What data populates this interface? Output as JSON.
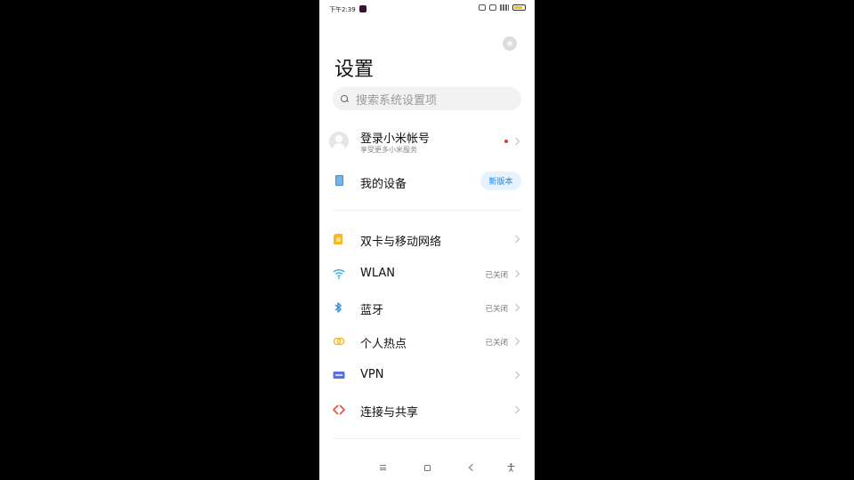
{
  "status_bar": {
    "time": "下午2:39"
  },
  "page": {
    "title": "设置"
  },
  "search": {
    "placeholder": "搜索系统设置项"
  },
  "account": {
    "title": "登录小米帐号",
    "subtitle": "享受更多小米服务"
  },
  "device": {
    "label": "我的设备",
    "badge": "新版本"
  },
  "items": [
    {
      "label": "双卡与移动网络",
      "status": "",
      "icon": "sim-card-icon",
      "color": "#f5b921"
    },
    {
      "label": "WLAN",
      "status": "已关闭",
      "icon": "wifi-icon",
      "color": "#2fa8e6"
    },
    {
      "label": "蓝牙",
      "status": "已关闭",
      "icon": "bluetooth-icon",
      "color": "#2f8fe0"
    },
    {
      "label": "个人热点",
      "status": "已关闭",
      "icon": "hotspot-icon",
      "color": "#f5b921"
    },
    {
      "label": "VPN",
      "status": "",
      "icon": "vpn-icon",
      "color": "#5b6ee0"
    },
    {
      "label": "连接与共享",
      "status": "",
      "icon": "connection-share-icon",
      "color": "#e6503c"
    }
  ],
  "nav": {
    "icons": [
      "menu-icon",
      "home-icon",
      "back-icon",
      "accessibility-icon"
    ]
  }
}
